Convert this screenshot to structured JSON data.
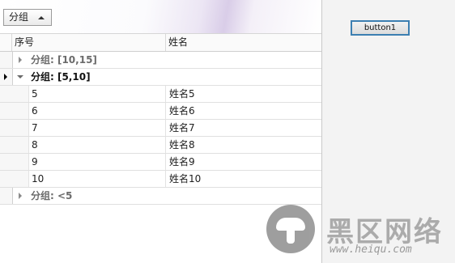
{
  "group_panel": {
    "chip_label": "分组"
  },
  "columns": [
    "序号",
    "姓名"
  ],
  "groups": [
    {
      "label": "分组: [10,15]",
      "expanded": false
    },
    {
      "label": "分组: [5,10]",
      "expanded": true
    },
    {
      "label": "分组: <5",
      "expanded": false
    }
  ],
  "rows": [
    {
      "index": "5",
      "name": "姓名5"
    },
    {
      "index": "6",
      "name": "姓名6"
    },
    {
      "index": "7",
      "name": "姓名7"
    },
    {
      "index": "8",
      "name": "姓名8"
    },
    {
      "index": "9",
      "name": "姓名9"
    },
    {
      "index": "10",
      "name": "姓名10"
    }
  ],
  "button": {
    "label": "button1"
  },
  "watermark": {
    "title": "黑区网络",
    "url": "www.heiqu.com"
  },
  "colors": {
    "focus_border": "#3c7fb1",
    "group_text": "#6b6b6b"
  }
}
